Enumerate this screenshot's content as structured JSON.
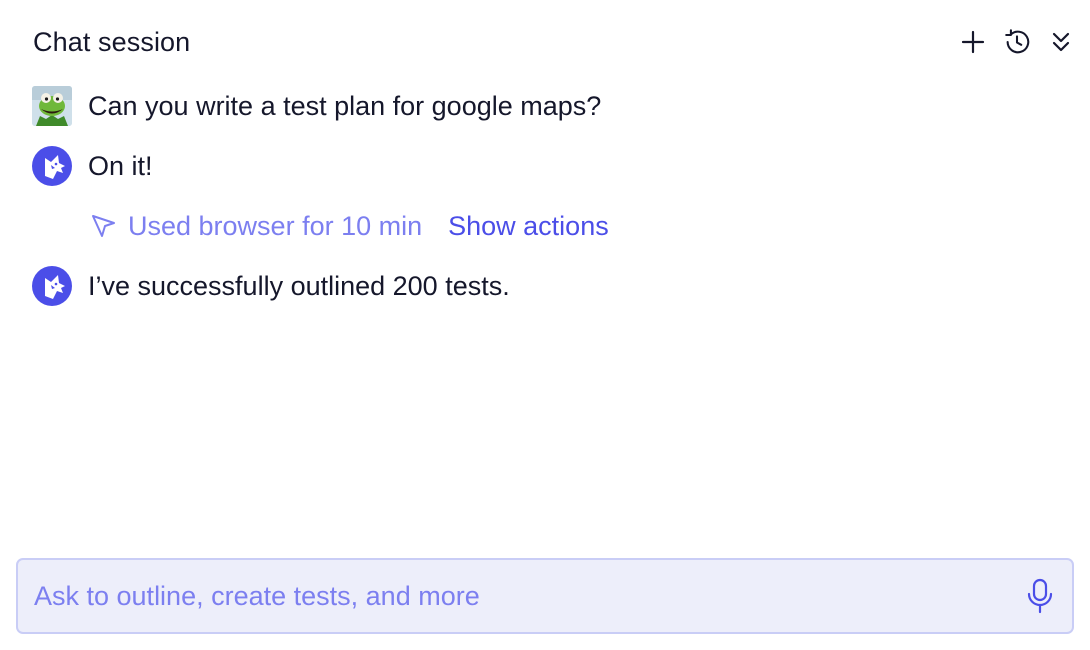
{
  "header": {
    "title": "Chat session",
    "actions": {
      "new_icon": "plus-icon",
      "history_icon": "history-icon",
      "collapse_icon": "chevrons-down-icon"
    }
  },
  "messages": [
    {
      "author": "user",
      "avatar": "kermit-avatar",
      "text": "Can you write a test plan for google maps?"
    },
    {
      "author": "assistant",
      "avatar": "wolf-logo-avatar",
      "text": "On it!"
    },
    {
      "author": "assistant",
      "avatar": "wolf-logo-avatar",
      "text": "I’ve successfully outlined 200 tests."
    }
  ],
  "tool_activity": {
    "icon": "cursor-pointer-icon",
    "used_text": "Used browser for 10 min",
    "show_actions_label": "Show actions"
  },
  "composer": {
    "value": "",
    "placeholder": "Ask to outline, create tests, and more",
    "mic_icon": "microphone-icon"
  },
  "colors": {
    "accent": "#4b4ee8",
    "accent_light": "#7c7ff0",
    "composer_bg": "#edeefa",
    "composer_border": "#c9cdf6",
    "text": "#15172b"
  }
}
